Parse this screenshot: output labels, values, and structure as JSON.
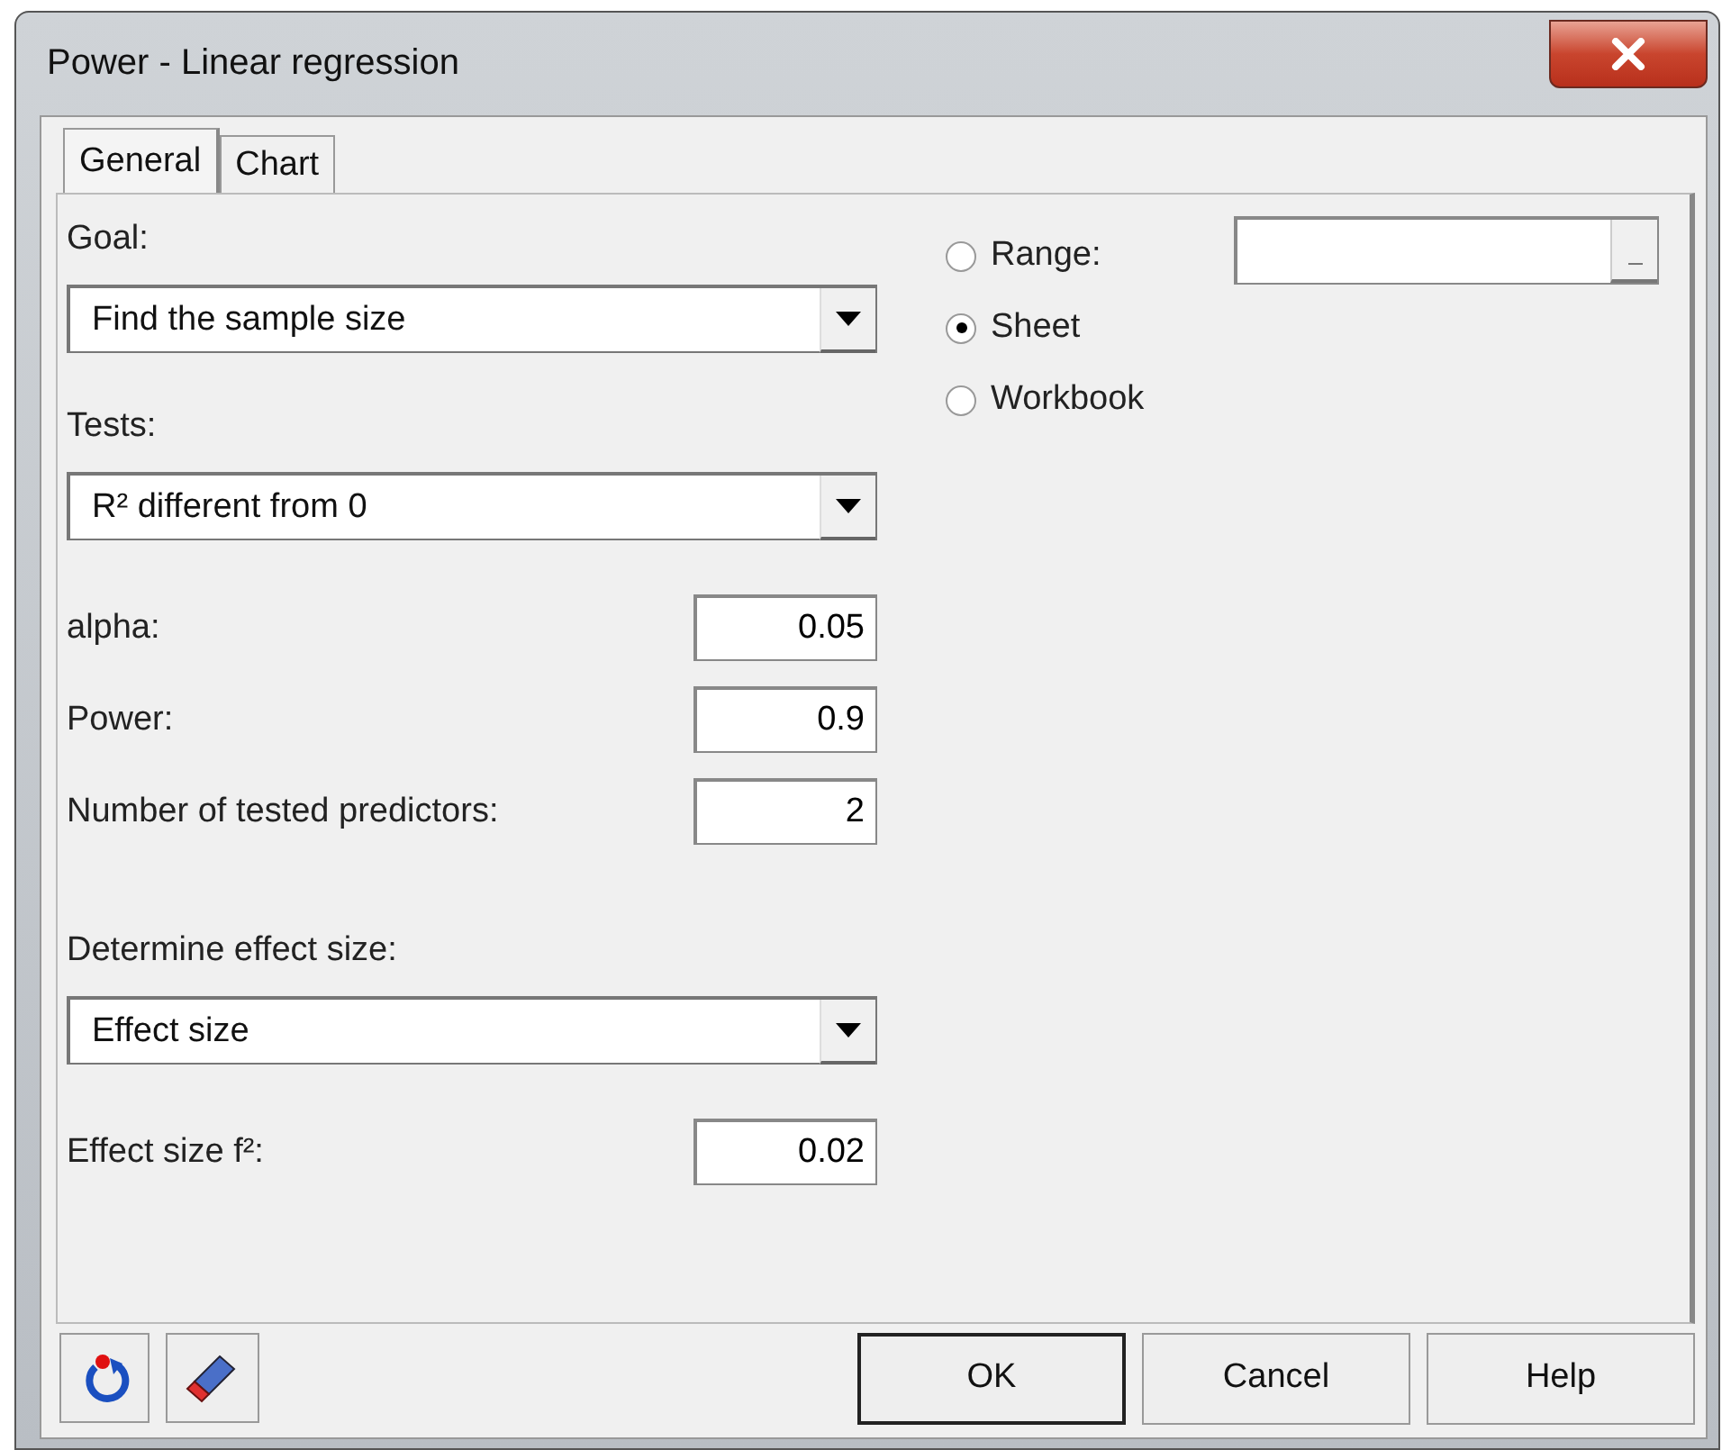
{
  "window": {
    "title": "Power - Linear regression"
  },
  "tabs": [
    {
      "label": "General",
      "selected": true
    },
    {
      "label": "Chart",
      "selected": false
    }
  ],
  "fields": [
    {
      "kind": "dropdown",
      "label": "Goal:",
      "value": "Find the sample size"
    },
    {
      "kind": "dropdown",
      "label": "Tests:",
      "value": "R² different from 0"
    },
    {
      "kind": "number",
      "label": "alpha:",
      "value": "0.05"
    },
    {
      "kind": "number",
      "label": "Power:",
      "value": "0.9"
    },
    {
      "kind": "number",
      "label": "Number of tested predictors:",
      "value": "2"
    },
    {
      "kind": "dropdown",
      "label": "Determine effect size:",
      "value": "Effect size"
    },
    {
      "kind": "number",
      "label": "Effect size f²:",
      "value": "0.02"
    }
  ],
  "output": [
    {
      "kind": "range",
      "label": "Range:",
      "selected": false
    },
    {
      "kind": "plain",
      "label": "Sheet",
      "selected": true
    },
    {
      "kind": "plain",
      "label": "Workbook",
      "selected": false
    }
  ],
  "buttons": [
    {
      "label": "OK",
      "default": true
    },
    {
      "label": "Cancel",
      "default": false
    },
    {
      "label": "Help",
      "default": false
    }
  ]
}
